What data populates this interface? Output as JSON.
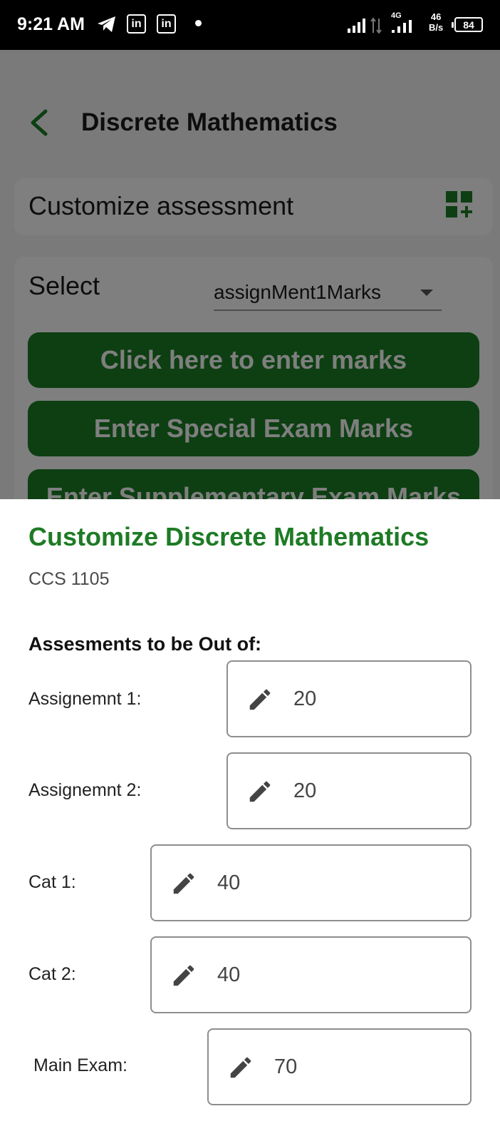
{
  "status_bar": {
    "time": "9:21 AM",
    "linkedin_1": "in",
    "linkedin_2": "in",
    "net_4g": "4G",
    "speed_value": "46",
    "speed_unit": "B/s",
    "battery": "84"
  },
  "app_bar": {
    "title": "Discrete Mathematics"
  },
  "customize_card": {
    "label": "Customize assessment"
  },
  "select_card": {
    "label": "Select",
    "dropdown_value": "assignMent1Marks",
    "buttons": [
      "Click here to enter marks",
      "Enter Special Exam Marks",
      "Enter Supplementary Exam Marks"
    ]
  },
  "sheet": {
    "title": "Customize Discrete Mathematics",
    "course_code": "CCS 1105",
    "subheading": "Assesments to be Out of:",
    "rows": [
      {
        "label": "Assignemnt 1:",
        "value": "20"
      },
      {
        "label": "Assignemnt 2:",
        "value": "20"
      },
      {
        "label": "Cat 1:",
        "value": "40"
      },
      {
        "label": "Cat 2:",
        "value": "40"
      },
      {
        "label": "Main Exam:",
        "value": "70"
      }
    ]
  },
  "colors": {
    "accent_green": "#1e7b25",
    "button_green": "#1b7f24",
    "status_bar": "#000000"
  },
  "icons": [
    "telegram-icon",
    "linkedin-icon",
    "signal-icon",
    "data-arrows-icon",
    "battery-icon",
    "back-chevron-icon",
    "grid-add-icon",
    "dropdown-caret-icon",
    "pencil-icon"
  ]
}
